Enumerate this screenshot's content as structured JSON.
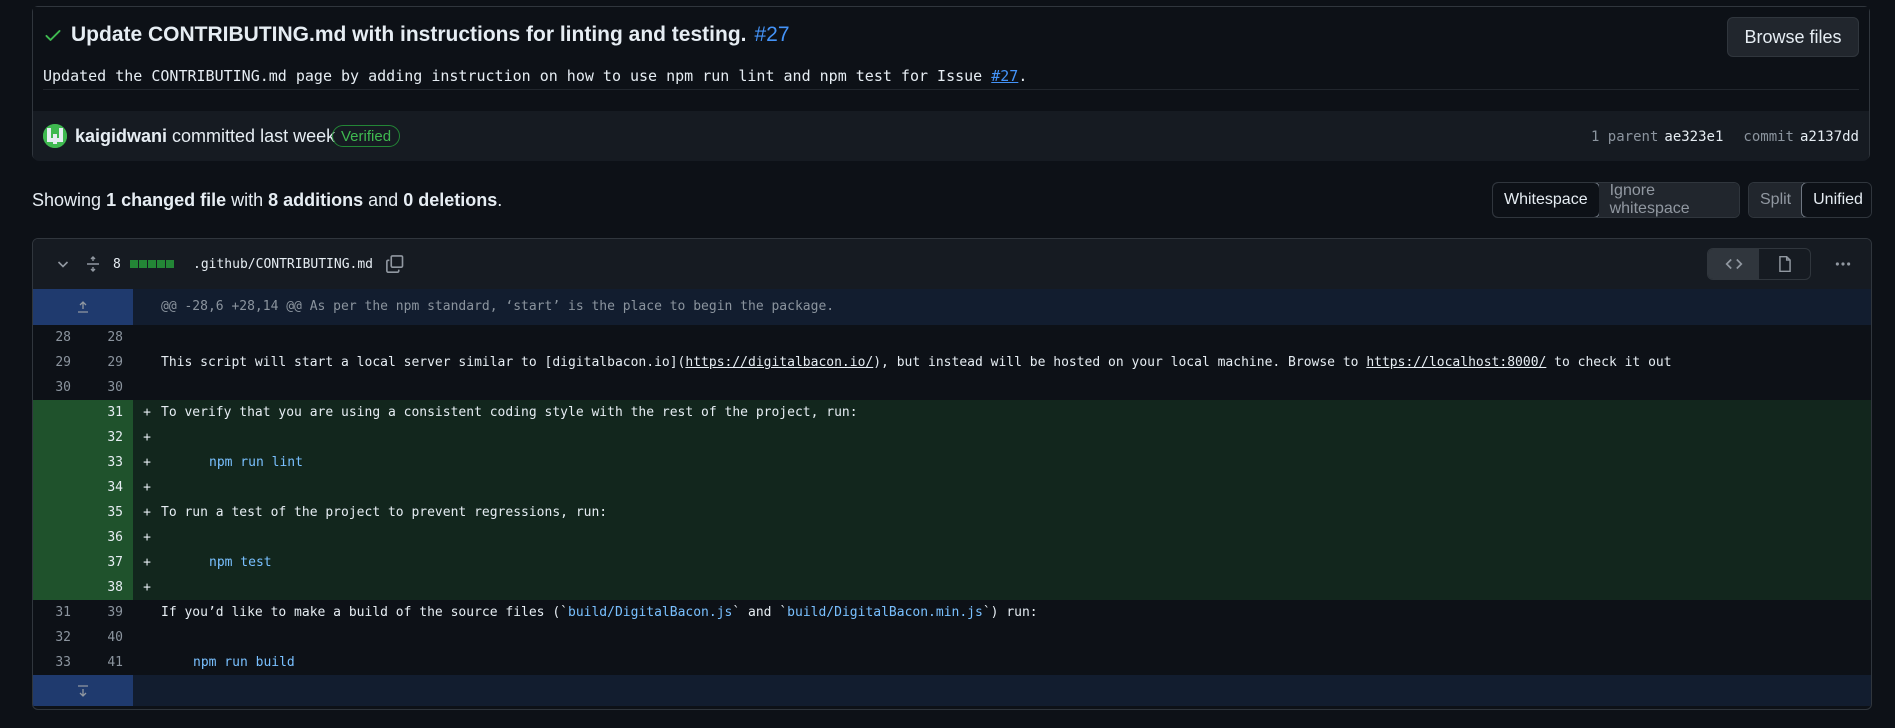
{
  "commit": {
    "title": "Update CONTRIBUTING.md with instructions for linting and testing.",
    "issue_ref": "#27",
    "description_pre": "Updated the CONTRIBUTING.md page by adding instruction on how to use npm run lint and npm test for Issue ",
    "description_issue": "#27",
    "description_post": ".",
    "browse_label": "Browse files",
    "author": "kaigidwani",
    "committed_text": "committed last week",
    "verified_label": "Verified",
    "parent_label": "1 parent",
    "parent_sha": "ae323e1",
    "commit_label": "commit",
    "commit_sha": "a2137dd"
  },
  "summary": {
    "prefix": "Showing ",
    "changed": "1 changed file",
    "with": " with ",
    "additions": "8 additions",
    "and": " and ",
    "deletions": "0 deletions",
    "suffix": "."
  },
  "toolbar": {
    "whitespace": "Whitespace",
    "ignore_whitespace": "Ignore whitespace",
    "split": "Split",
    "unified": "Unified"
  },
  "file": {
    "additions_count": "8",
    "path": ".github/CONTRIBUTING.md",
    "hunk_header": "@@ -28,6 +28,14 @@ As per the npm standard, ‘start’ is the place to begin the package."
  },
  "lines": [
    {
      "old": "28",
      "new": "28",
      "type": "ctx",
      "text": ""
    },
    {
      "old": "29",
      "new": "29",
      "type": "ctx",
      "text": "This script will start a local server similar to [digitalbacon.io](",
      "link1": "https://digitalbacon.io/",
      "mid": "), but instead will be hosted on your local machine. Browse to ",
      "link2": "https://localhost:8000/",
      "tail": " to check it out"
    },
    {
      "old": "30",
      "new": "30",
      "type": "ctx",
      "text": ""
    },
    {
      "old": "",
      "new": "31",
      "type": "add",
      "text": "To verify that you are using a consistent coding style with the rest of the project, run:"
    },
    {
      "old": "",
      "new": "32",
      "type": "add",
      "text": ""
    },
    {
      "old": "",
      "new": "33",
      "type": "add",
      "text": "npm run lint",
      "cmd": true
    },
    {
      "old": "",
      "new": "34",
      "type": "add",
      "text": ""
    },
    {
      "old": "",
      "new": "35",
      "type": "add",
      "text": "To run a test of the project to prevent regressions, run:"
    },
    {
      "old": "",
      "new": "36",
      "type": "add",
      "text": ""
    },
    {
      "old": "",
      "new": "37",
      "type": "add",
      "text": "npm test",
      "cmd": true
    },
    {
      "old": "",
      "new": "38",
      "type": "add",
      "text": ""
    },
    {
      "old": "31",
      "new": "39",
      "type": "ctx",
      "text": "If you’d like to make a build of the source files (`",
      "code1": "build/DigitalBacon.js",
      "mid": "` and `",
      "code2": "build/DigitalBacon.min.js",
      "tail": "`) run:"
    },
    {
      "old": "32",
      "new": "40",
      "type": "ctx",
      "text": ""
    },
    {
      "old": "33",
      "new": "41",
      "type": "ctx",
      "text": "npm run build",
      "cmd": true,
      "indent": "small"
    }
  ],
  "colors": {
    "background": "#0d1117",
    "accent_blue": "#4493f8",
    "addition_green": "#3fb950"
  }
}
